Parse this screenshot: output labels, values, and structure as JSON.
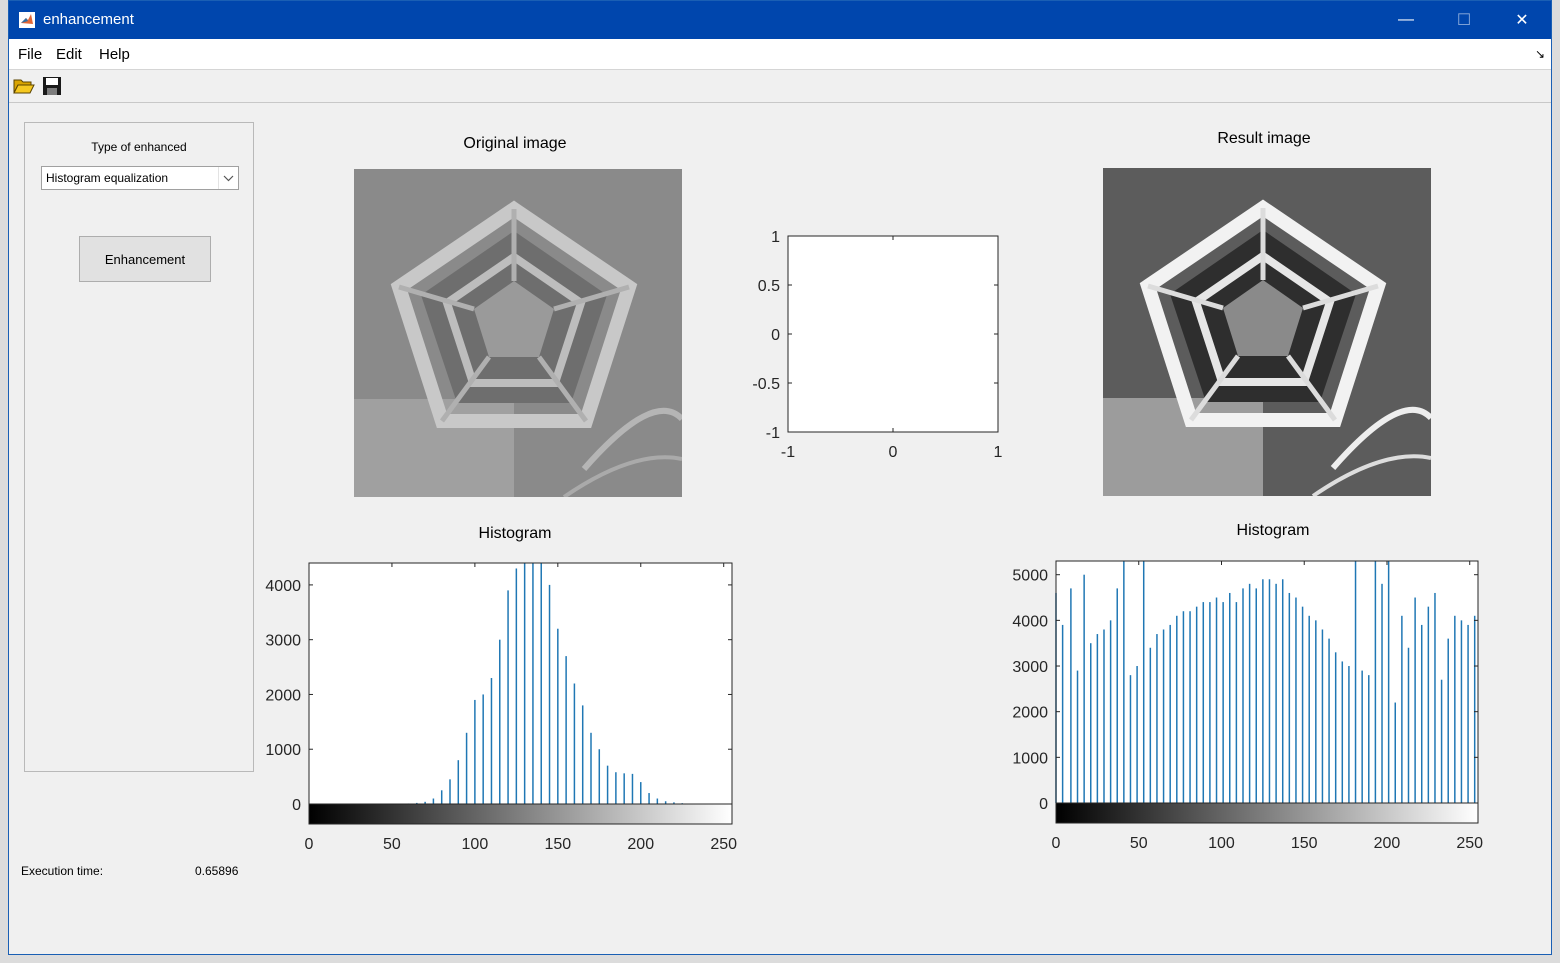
{
  "window": {
    "title": "enhancement",
    "controls": {
      "minimize": "—",
      "maximize": "☐",
      "close": "✕"
    }
  },
  "menu": {
    "items": [
      "File",
      "Edit",
      "Help"
    ],
    "undock_icon": "undock-arrow-icon"
  },
  "toolbar": {
    "icons": [
      "open-folder-icon",
      "save-disk-icon"
    ]
  },
  "control_panel": {
    "type_label": "Type of enhanced",
    "type_selected": "Histogram equalization",
    "enhance_button": "Enhancement"
  },
  "execution": {
    "label": "Execution time:",
    "value": "0.65896"
  },
  "images": {
    "original_title": "Original image",
    "result_title": "Result image"
  },
  "colors": {
    "bar": "#1f77b4",
    "titlebar": "#0046ad"
  },
  "chart_data": [
    {
      "type": "axes",
      "title": "",
      "xlim": [
        -1,
        1
      ],
      "ylim": [
        -1,
        1
      ],
      "xticks": [
        "-1",
        "0",
        "1"
      ],
      "yticks": [
        "1",
        "0.5",
        "0",
        "-0.5",
        "-1"
      ],
      "x": [],
      "values": []
    },
    {
      "type": "bar",
      "title": "Histogram",
      "xlim": [
        0,
        255
      ],
      "ylim": [
        0,
        4400
      ],
      "xticks": [
        "0",
        "50",
        "100",
        "150",
        "200",
        "250"
      ],
      "yticks": [
        "4000",
        "3000",
        "2000",
        "1000",
        "0"
      ],
      "colorbar": "grayscale",
      "x": [
        60,
        65,
        70,
        75,
        80,
        85,
        90,
        95,
        100,
        105,
        110,
        115,
        120,
        125,
        130,
        135,
        140,
        145,
        150,
        155,
        160,
        165,
        170,
        175,
        180,
        185,
        190,
        195,
        200,
        205,
        210,
        215,
        220,
        225,
        230
      ],
      "values": [
        10,
        20,
        40,
        100,
        250,
        450,
        800,
        1300,
        1900,
        2000,
        2300,
        3000,
        3900,
        4300,
        4400,
        4400,
        4400,
        4000,
        3200,
        2700,
        2200,
        1800,
        1300,
        1000,
        700,
        580,
        560,
        550,
        400,
        200,
        100,
        50,
        30,
        15,
        5
      ]
    },
    {
      "type": "bar",
      "title": "Histogram",
      "xlim": [
        0,
        255
      ],
      "ylim": [
        0,
        5300
      ],
      "xticks": [
        "0",
        "50",
        "100",
        "150",
        "200",
        "250"
      ],
      "yticks": [
        "5000",
        "4000",
        "3000",
        "2000",
        "1000",
        "0"
      ],
      "colorbar": "grayscale",
      "x": [
        0,
        4,
        9,
        13,
        17,
        21,
        25,
        29,
        33,
        37,
        41,
        45,
        49,
        53,
        57,
        61,
        65,
        69,
        73,
        77,
        81,
        85,
        89,
        93,
        97,
        101,
        105,
        109,
        113,
        117,
        121,
        125,
        129,
        133,
        137,
        141,
        145,
        149,
        153,
        157,
        161,
        165,
        169,
        173,
        177,
        181,
        185,
        189,
        193,
        197,
        201,
        205,
        209,
        213,
        217,
        221,
        225,
        229,
        233,
        237,
        241,
        245,
        249,
        253
      ],
      "values": [
        4600,
        3900,
        4700,
        2900,
        5000,
        3500,
        3700,
        3800,
        4000,
        4700,
        5300,
        2800,
        3000,
        5300,
        3400,
        3700,
        3800,
        3900,
        4100,
        4200,
        4200,
        4300,
        4400,
        4400,
        4500,
        4400,
        4600,
        4400,
        4700,
        4800,
        4700,
        4900,
        4900,
        4800,
        4900,
        4600,
        4500,
        4300,
        4100,
        4000,
        3800,
        3600,
        3300,
        3100,
        3000,
        5300,
        2900,
        2800,
        5300,
        4800,
        5300,
        2200,
        4100,
        3400,
        4500,
        3900,
        4300,
        4600,
        2700,
        3600,
        4100,
        4000,
        3900,
        4100
      ]
    }
  ]
}
